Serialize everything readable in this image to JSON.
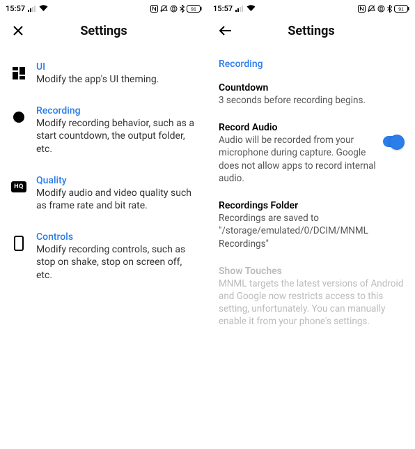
{
  "status": {
    "time": "15:57",
    "battery": "91"
  },
  "left": {
    "title": "Settings",
    "items": [
      {
        "title": "UI",
        "desc": "Modify the app's UI theming."
      },
      {
        "title": "Recording",
        "desc": "Modify recording behavior, such as a start countdown, the output folder, etc."
      },
      {
        "title": "Quality",
        "desc": "Modify audio and video quality such as frame rate and bit rate."
      },
      {
        "title": "Controls",
        "desc": "Modify recording controls, such as stop on shake, stop on screen off, etc."
      }
    ]
  },
  "right": {
    "title": "Settings",
    "section": "Recording",
    "settings": [
      {
        "title": "Countdown",
        "desc": "3 seconds before recording begins."
      },
      {
        "title": "Record Audio",
        "desc": "Audio will be recorded from your microphone during capture. Google does not allow apps to record internal audio.",
        "toggle_on": true
      },
      {
        "title": "Recordings Folder",
        "desc": "Recordings are saved to \"/storage/emulated/0/DCIM/MNML Recordings\""
      },
      {
        "title": "Show Touches",
        "desc": "MNML targets the latest versions of Android and Google now restricts access to this setting, unfortunately. You can manually enable it from your phone's settings.",
        "disabled": true
      }
    ]
  }
}
